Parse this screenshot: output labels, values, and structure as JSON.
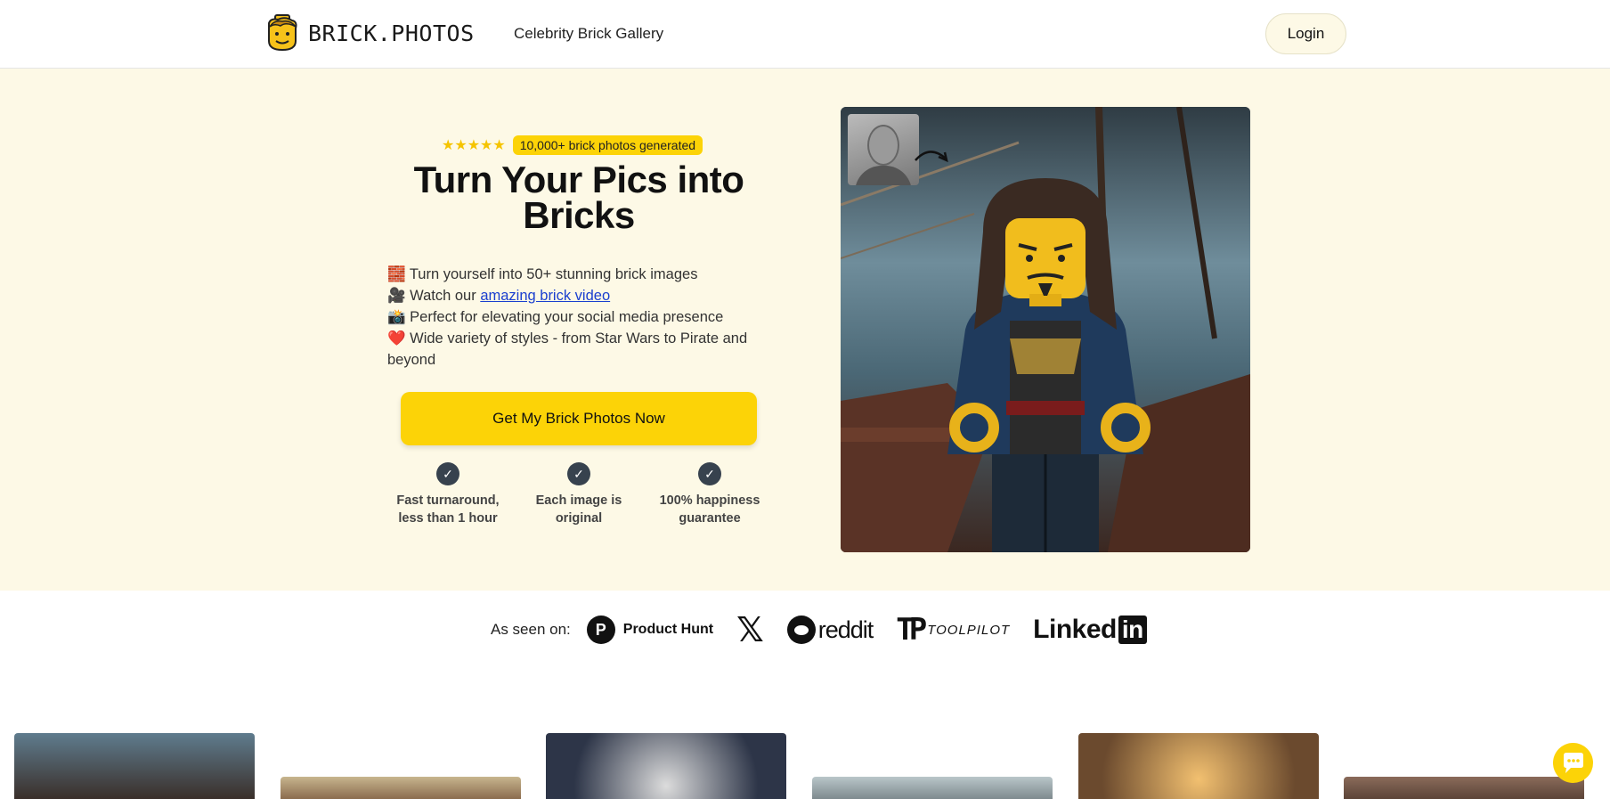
{
  "header": {
    "brand": "BRICK.PHOTOS",
    "nav_link": "Celebrity Brick Gallery",
    "login_label": "Login"
  },
  "hero": {
    "stars": "★★★★★",
    "rating_value": 5,
    "badge": "10,000+ brick photos generated",
    "title": "Turn Your Pics into Bricks",
    "features": [
      {
        "emoji": "🧱",
        "text": "Turn yourself into 50+ stunning brick images"
      },
      {
        "emoji": "🎥",
        "text": "Watch our ",
        "link": "amazing brick video"
      },
      {
        "emoji": "📸",
        "text": "Perfect for elevating your social media presence"
      },
      {
        "emoji": "❤️",
        "text": "Wide variety of styles - from Star Wars to Pirate and beyond"
      }
    ],
    "cta_label": "Get My Brick Photos Now",
    "guarantees": [
      "Fast turnaround, less than 1 hour",
      "Each image is original",
      "100% happiness guarantee"
    ],
    "check_icon": "✓"
  },
  "seen_on": {
    "label": "As seen on:",
    "product_hunt": {
      "mark": "P",
      "name": "Product Hunt"
    },
    "x_mark": "𝕏",
    "reddit": "reddit",
    "toolpilot": {
      "mark": "TP",
      "name": "TOOLPILOT"
    },
    "linkedin": {
      "text": "Linked",
      "box": "in"
    }
  },
  "colors": {
    "accent": "#fcd307",
    "hero_bg": "#fdf9e6",
    "link": "#1a3fcf",
    "check_bg": "#37424e"
  },
  "icons": {
    "logo": "brick-head-logo-icon",
    "chat": "chat-bubble-icon",
    "arrow": "curved-arrow-icon"
  }
}
